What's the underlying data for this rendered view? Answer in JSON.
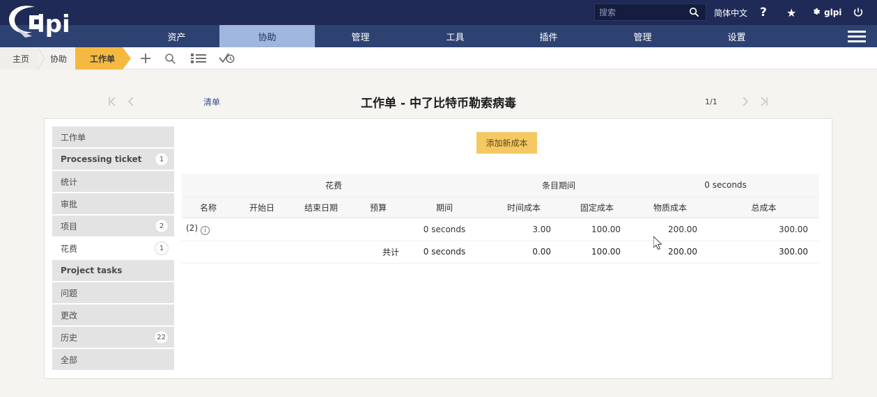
{
  "header": {
    "logo_text": "glpi",
    "search": {
      "placeholder": "搜索",
      "value": "",
      "icon": "search-icon"
    },
    "language": "简体中文",
    "help_icon": "?",
    "favorite_icon": "★",
    "settings_icon": "gear-icon",
    "user_label": "glpi",
    "power_icon": "power-icon"
  },
  "nav": {
    "items": [
      {
        "label": "资产",
        "active": false
      },
      {
        "label": "协助",
        "active": true
      },
      {
        "label": "管理",
        "active": false
      },
      {
        "label": "工具",
        "active": false
      },
      {
        "label": "插件",
        "active": false
      },
      {
        "label": "管理",
        "active": false
      },
      {
        "label": "设置",
        "active": false
      }
    ],
    "burger_icon": "menu-icon"
  },
  "breadcrumb": {
    "items": [
      {
        "label": "主页",
        "state": "default"
      },
      {
        "label": "协助",
        "state": "default"
      },
      {
        "label": "工作单",
        "state": "active"
      }
    ],
    "actions": [
      {
        "icon": "plus-icon",
        "label": "+"
      },
      {
        "icon": "search-icon",
        "label": ""
      },
      {
        "icon": "list-icon",
        "label": ""
      },
      {
        "icon": "check-clock-icon",
        "label": ""
      }
    ]
  },
  "titlebar": {
    "first_arrow": "|<",
    "prev_arrow": "<",
    "list_link": "清单",
    "title": "工作单 - 中了比特币勒索病毒",
    "pagination": "1/1",
    "next_arrow": ">",
    "last_arrow": ">|"
  },
  "sidebar": {
    "items": [
      {
        "label": "工作单",
        "badge": "",
        "bold": false,
        "active": false
      },
      {
        "label": "Processing ticket",
        "badge": "1",
        "bold": true,
        "active": false
      },
      {
        "label": "统计",
        "badge": "",
        "bold": false,
        "active": false
      },
      {
        "label": "审批",
        "badge": "",
        "bold": false,
        "active": false
      },
      {
        "label": "项目",
        "badge": "2",
        "bold": false,
        "active": false
      },
      {
        "label": "花费",
        "badge": "1",
        "bold": false,
        "active": true
      },
      {
        "label": "Project tasks",
        "badge": "",
        "bold": true,
        "active": false
      },
      {
        "label": "问题",
        "badge": "",
        "bold": false,
        "active": false
      },
      {
        "label": "更改",
        "badge": "",
        "bold": false,
        "active": false
      },
      {
        "label": "历史",
        "badge": "22",
        "bold": false,
        "active": false
      },
      {
        "label": "全部",
        "badge": "",
        "bold": false,
        "active": false
      }
    ]
  },
  "main": {
    "add_button": "添加新成本",
    "table": {
      "section_title": "花费",
      "duration_label": "条目期间",
      "duration_value": "0 seconds",
      "columns": [
        "名称",
        "开始日",
        "结束日期",
        "预算",
        "期间",
        "时间成本",
        "固定成本",
        "物质成本",
        "总成本"
      ],
      "rows": [
        {
          "name": "(2)",
          "info_icon": "info-icon",
          "start": "",
          "end": "",
          "budget": "",
          "period": "0 seconds",
          "time_cost": "3.00",
          "fixed_cost": "100.00",
          "material_cost": "200.00",
          "total_cost": "300.00"
        }
      ],
      "total_row": {
        "label": "共计",
        "period": "0 seconds",
        "time_cost": "0.00",
        "fixed_cost": "100.00",
        "material_cost": "200.00",
        "total_cost": "300.00"
      }
    }
  },
  "colors": {
    "topbar": "#1f2a56",
    "nav": "#2e4272",
    "nav_active": "#9fb6dd",
    "breadcrumb_active": "#f5b942",
    "button": "#f4c863",
    "page_bg": "#f5f4f0"
  }
}
